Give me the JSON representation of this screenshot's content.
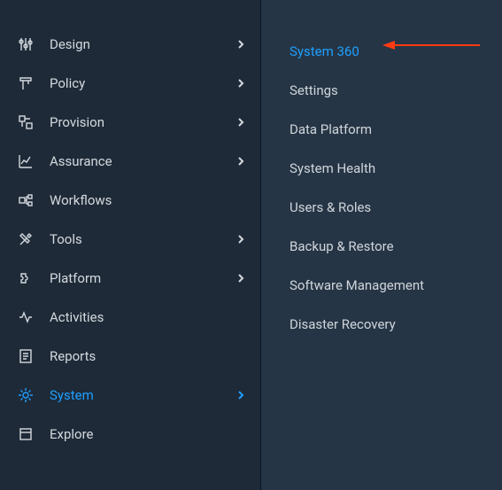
{
  "sidebar": {
    "items": [
      {
        "label": "Design",
        "icon": "sliders-icon",
        "has_submenu": true,
        "active": false
      },
      {
        "label": "Policy",
        "icon": "policy-icon",
        "has_submenu": true,
        "active": false
      },
      {
        "label": "Provision",
        "icon": "provision-icon",
        "has_submenu": true,
        "active": false
      },
      {
        "label": "Assurance",
        "icon": "chart-line-icon",
        "has_submenu": true,
        "active": false
      },
      {
        "label": "Workflows",
        "icon": "workflow-icon",
        "has_submenu": false,
        "active": false
      },
      {
        "label": "Tools",
        "icon": "tools-icon",
        "has_submenu": true,
        "active": false
      },
      {
        "label": "Platform",
        "icon": "puzzle-icon",
        "has_submenu": true,
        "active": false
      },
      {
        "label": "Activities",
        "icon": "activity-icon",
        "has_submenu": false,
        "active": false
      },
      {
        "label": "Reports",
        "icon": "reports-icon",
        "has_submenu": false,
        "active": false
      },
      {
        "label": "System",
        "icon": "gear-icon",
        "has_submenu": true,
        "active": true
      },
      {
        "label": "Explore",
        "icon": "explore-icon",
        "has_submenu": false,
        "active": false
      }
    ]
  },
  "submenu": {
    "items": [
      {
        "label": "System 360",
        "active": true
      },
      {
        "label": "Settings",
        "active": false
      },
      {
        "label": "Data Platform",
        "active": false
      },
      {
        "label": "System Health",
        "active": false
      },
      {
        "label": "Users & Roles",
        "active": false
      },
      {
        "label": "Backup & Restore",
        "active": false
      },
      {
        "label": "Software Management",
        "active": false
      },
      {
        "label": "Disaster Recovery",
        "active": false
      }
    ]
  },
  "colors": {
    "accent": "#1ea0ff",
    "bg_primary": "#1e2a38",
    "bg_secondary": "#263545",
    "text": "#d4d9de",
    "annotation": "#ff3b12"
  }
}
